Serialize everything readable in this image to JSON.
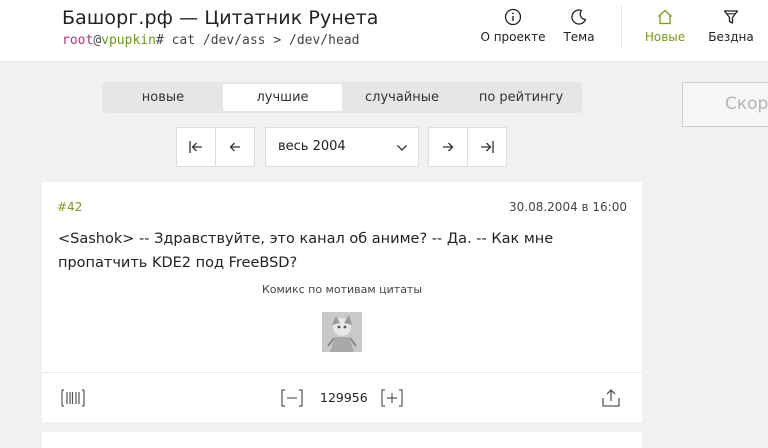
{
  "header": {
    "site_title": "Башорг.рф — Цитатник Рунета",
    "prompt_user": "root",
    "prompt_at": "@",
    "prompt_host": "vpupkin",
    "prompt_command": "# cat /dev/ass > /dev/head",
    "nav": {
      "about": {
        "label": "О проекте",
        "icon": "info-icon"
      },
      "theme": {
        "label": "Тема",
        "icon": "moon-icon"
      },
      "new": {
        "label": "Новые",
        "icon": "home-icon"
      },
      "abyss": {
        "label": "Бездна",
        "icon": "funnel-icon"
      }
    }
  },
  "tabs": [
    {
      "label": "новые"
    },
    {
      "label": "лучшие",
      "active": true
    },
    {
      "label": "случайные"
    },
    {
      "label": "по рейтингу"
    }
  ],
  "pager": {
    "period": "весь 2004"
  },
  "search": {
    "placeholder": "Скоро"
  },
  "quote": {
    "id": "#42",
    "date": "30.08.2004 в 16:00",
    "text": "<Sashok> -- Здравствуйте, это канал об аниме? -- Да. -- Как мне пропатчить KDE2 под FreeBSD?",
    "comic_label": "Комикс по мотивам цитаты",
    "rating": "129956"
  },
  "colors": {
    "accent": "#7a9a1a",
    "prompt_user": "#b8307a",
    "background": "#f1f1ef"
  }
}
